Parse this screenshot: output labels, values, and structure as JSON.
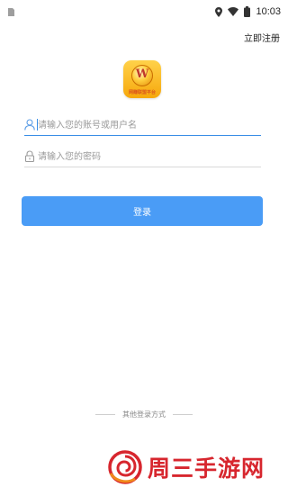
{
  "status_bar": {
    "time": "10:03",
    "icons": [
      "sim-icon",
      "location-icon",
      "wifi-icon",
      "battery-icon"
    ]
  },
  "header": {
    "register_label": "立即注册"
  },
  "logo": {
    "letter": "W",
    "caption": "网赚联盟平台"
  },
  "form": {
    "account": {
      "value": "",
      "placeholder": "请输入您的账号或用户名",
      "icon": "user-icon"
    },
    "password": {
      "value": "",
      "placeholder": "请输入您的密码",
      "icon": "lock-icon"
    },
    "login_label": "登录"
  },
  "other_login": {
    "label": "其他登录方式"
  },
  "watermark": {
    "text": "周三手游网"
  },
  "colors": {
    "accent": "#4a9cf6",
    "focus_underline": "#3a8ee6",
    "watermark": "#d7262e",
    "logo_gold": "#f6a80c"
  }
}
